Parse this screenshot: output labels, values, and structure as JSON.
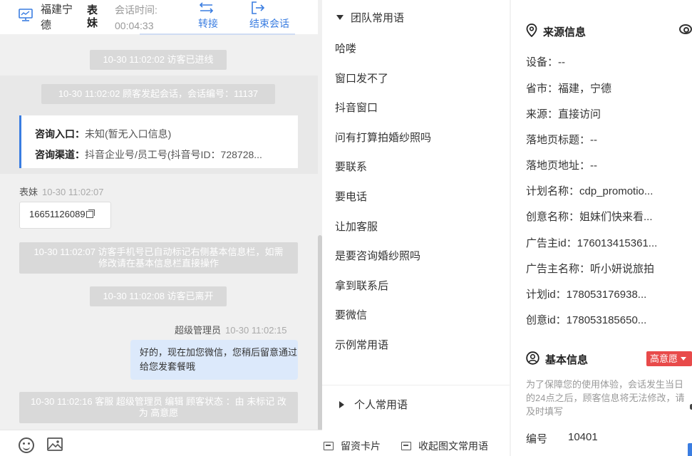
{
  "header": {
    "customer_name": "福建宁德",
    "nickname": "表妹",
    "session_time_label": "会话时间:",
    "session_time": "00:04:33",
    "transfer_label": "转接",
    "end_label": "结束会话"
  },
  "messages": {
    "sys_entered": "10-30 11:02:02 访客已进线",
    "sys_started": "10-30 11:02:02 顾客发起会话，会话编号：11137",
    "card": {
      "entry_label": "咨询入口：",
      "entry_value": "未知(暂无入口信息)",
      "channel_label": "咨询渠道：",
      "channel_value": "抖音企业号/员工号(抖音号ID：728728..."
    },
    "visitor_name": "表妹",
    "visitor_time": "10-30 11:02:07",
    "phone": "16651126089",
    "sys_phone_marked": "10-30 11:02:07 访客手机号已自动标记右侧基本信息栏，如需修改请在基本信息栏直接操作",
    "sys_left": "10-30 11:02:08 访客已离开",
    "agent_name": "超级管理员",
    "agent_time": "10-30 11:02:15",
    "agent_text": "好的，现在加您微信，您稍后留意通过给您发套餐哦",
    "sys_status": "10-30 11:02:16 客服 超级管理员 编辑 顾客状态 ：由 未标记 改为 高意愿"
  },
  "phrases": {
    "team_title": "团队常用语",
    "items": [
      "哈喽",
      "窗口发不了",
      "抖音窗口",
      "问有打算拍婚纱照吗",
      "要联系",
      "要电话",
      "让加客服",
      "是要咨询婚纱照吗",
      "拿到联系后",
      "要微信",
      "示例常用语"
    ],
    "personal_title": "个人常用语",
    "card_btn": "留资卡片",
    "collapse_btn": "收起图文常用语"
  },
  "info": {
    "source_title": "来源信息",
    "fields": [
      "设备：--",
      "省市：福建，宁德",
      "来源：直接访问",
      "落地页标题：--",
      "落地页地址：--",
      "计划名称：cdp_promotio...",
      "创意名称：姐妹们快来看...",
      "广告主id：176013415361...",
      "广告主名称：听小妍说旅拍",
      "计划id：178053176938...",
      "创意id：178053185650..."
    ],
    "basic_title": "基本信息",
    "intent_badge": "高意愿",
    "notice": "为了保障您的使用体验，会话发生当日的24点之后，顾客信息将无法修改，请及时填写",
    "id_label": "编号",
    "id_value": "10401"
  },
  "colors": {
    "accent": "#3a7de1",
    "badge": "#e84a4a",
    "bubble": "#dce9fb"
  }
}
